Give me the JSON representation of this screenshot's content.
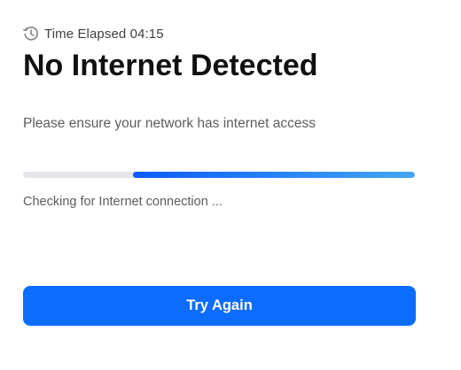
{
  "elapsed": {
    "icon": "clock-history-icon",
    "label": "Time Elapsed",
    "value": "04:15"
  },
  "heading": "No Internet Detected",
  "subtitle": "Please ensure your network has internet access",
  "progress": {
    "start_fraction": 0.28,
    "end_fraction": 1.0,
    "colors": {
      "track": "#e4e6e9",
      "fill_start": "#0b5cff",
      "fill_end": "#44a6f2"
    }
  },
  "status": "Checking for Internet connection ...",
  "button": {
    "label": "Try Again",
    "color": "#0b6cff"
  }
}
